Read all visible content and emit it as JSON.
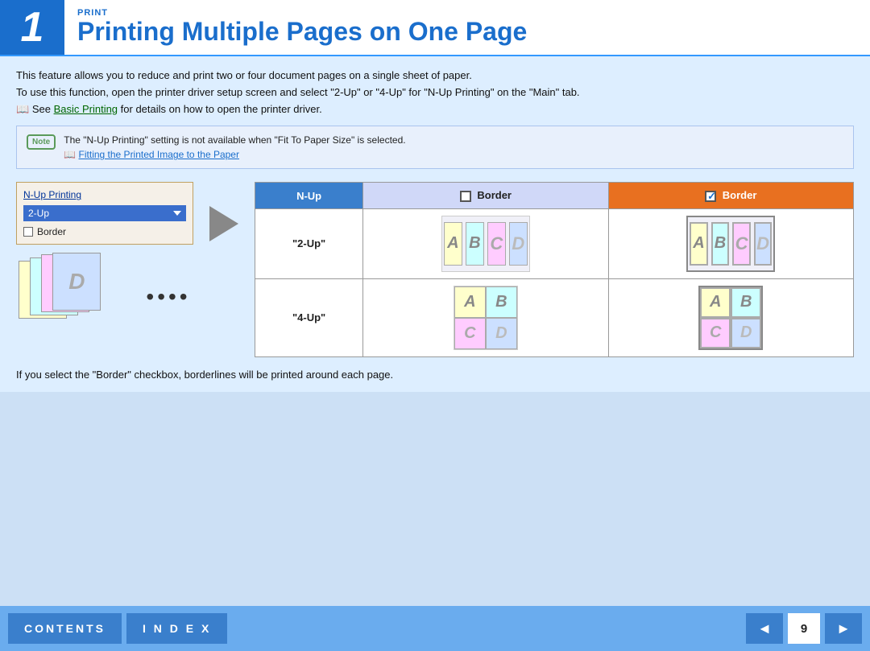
{
  "header": {
    "number": "1",
    "section_label": "PRINT",
    "title": "Printing Multiple Pages on One Page"
  },
  "intro": {
    "line1": "This feature allows you to reduce and print two or four document pages on a single sheet of paper.",
    "line2": "To use this function, open the printer driver setup screen and select \"2-Up\" or \"4-Up\" for \"N-Up Printing\" on the \"Main\" tab.",
    "line3_prefix": "See ",
    "line3_link": "Basic Printing",
    "line3_suffix": " for details on how to open the printer driver."
  },
  "note": {
    "badge": "Note",
    "text": "The \"N-Up Printing\" setting is not available when \"Fit To Paper Size\" is selected.",
    "link": "Fitting the Printed Image to the Paper"
  },
  "dialog": {
    "title": "N-Up Printing",
    "dropdown_value": "2-Up",
    "checkbox_label": "Border"
  },
  "table": {
    "col1_header": "N-Up",
    "col2_header": "Border",
    "col3_header": "Border",
    "row1_label": "\"2-Up\"",
    "row2_label": "\"4-Up\""
  },
  "bottom_text": "If you select the \"Border\" checkbox, borderlines will be printed around each page.",
  "footer": {
    "contents_label": "CONTENTS",
    "index_label": "I N D E X",
    "page_number": "9",
    "prev_icon": "◄",
    "next_icon": "►"
  },
  "colors": {
    "header_blue": "#1a6ecc",
    "accent_orange": "#e87020",
    "table_header_blue": "#3a7fcc",
    "table_header_light": "#d0d8f8",
    "page_a_bg": "#ffffcc",
    "page_b_bg": "#ccffff",
    "page_c_bg": "#ffccff",
    "page_d_bg": "#cce0ff"
  }
}
